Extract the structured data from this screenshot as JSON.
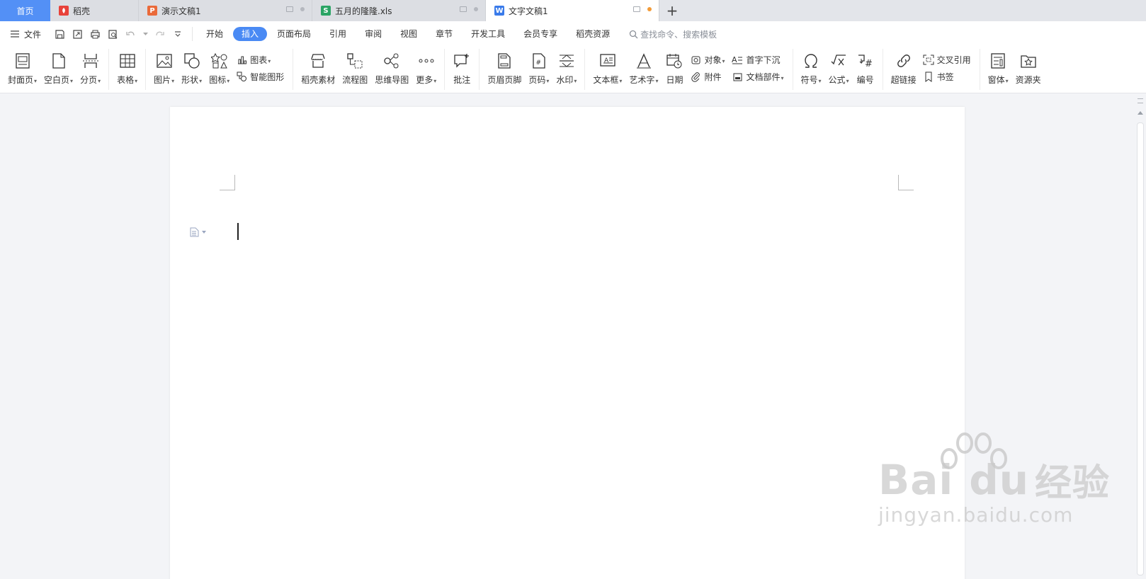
{
  "tabs": [
    {
      "label": "首页",
      "type": "home"
    },
    {
      "label": "稻壳",
      "icon": "docer-icon",
      "color": "#e8423a"
    },
    {
      "label": "演示文稿1",
      "icon": "presentation-icon",
      "color": "#ea6a3a"
    },
    {
      "label": "五月的隆隆.xls",
      "icon": "spreadsheet-icon",
      "color": "#2aa464"
    },
    {
      "label": "文字文稿1",
      "icon": "writer-icon",
      "color": "#3a7bea"
    }
  ],
  "menu": {
    "file": "文件",
    "items": [
      "开始",
      "插入",
      "页面布局",
      "引用",
      "审阅",
      "视图",
      "章节",
      "开发工具",
      "会员专享",
      "稻壳资源"
    ],
    "active": "插入",
    "search_placeholder": "查找命令、搜索模板"
  },
  "ribbon": {
    "cover": "封面页",
    "blank": "空白页",
    "pagebreak": "分页",
    "table": "表格",
    "picture": "图片",
    "shape": "形状",
    "icons": "图标",
    "chart": "图表",
    "smartart": "智能图形",
    "docer_material": "稻壳素材",
    "flowchart": "流程图",
    "mindmap": "思维导图",
    "more": "更多",
    "comment": "批注",
    "header_footer": "页眉页脚",
    "page_number": "页码",
    "watermark": "水印",
    "textbox": "文本框",
    "wordart": "艺术字",
    "date": "日期",
    "object": "对象",
    "attachment": "附件",
    "dropcap": "首字下沉",
    "doc_parts": "文档部件",
    "symbol": "符号",
    "formula": "公式",
    "numbering": "编号",
    "hyperlink": "超链接",
    "crossref": "交叉引用",
    "bookmark": "书签",
    "window": "窗体",
    "resources": "资源夹"
  },
  "watermark": {
    "brand": "Bai",
    "brand2": "du",
    "cn": "经验",
    "url": "jingyan.baidu.com"
  },
  "colors": {
    "accent": "#4a8af4",
    "home_tab": "#5390f6"
  }
}
